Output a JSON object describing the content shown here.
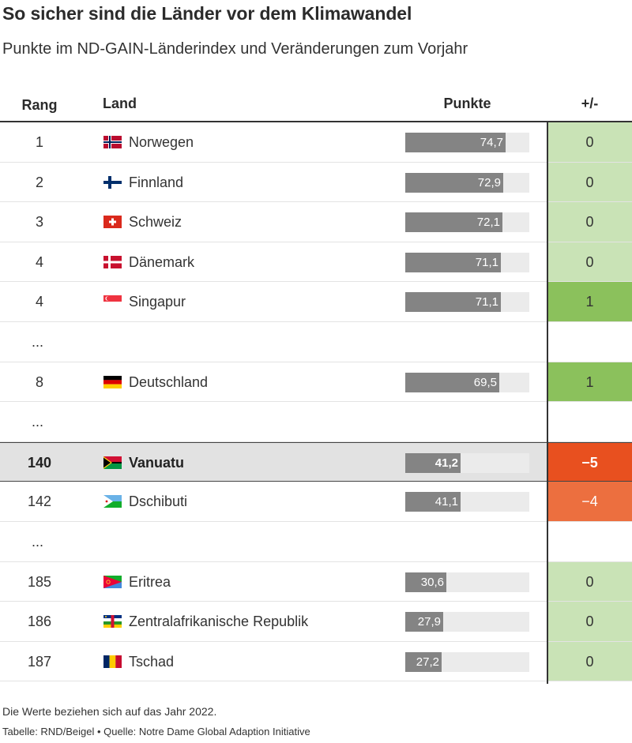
{
  "header": {
    "title": "So sicher sind die Länder vor dem Klimawandel",
    "subtitle": "Punkte im ND-GAIN-Länderindex und Veränderungen zum Vorjahr"
  },
  "columns": {
    "rank": "Rang",
    "country": "Land",
    "points": "Punkte",
    "change": "+/-"
  },
  "colors": {
    "bar": "#848484",
    "track": "#ebebeb",
    "change_zero": "#c9e3b6",
    "change_up": "#8bc15c",
    "change_down_strong": "#e8501f",
    "change_down": "#ec6f3f"
  },
  "chart_data": {
    "type": "table",
    "title": "So sicher sind die Länder vor dem Klimawandel",
    "subtitle": "Punkte im ND-GAIN-Länderindex und Veränderungen zum Vorjahr",
    "bar_scale_max": 92,
    "rows": [
      {
        "kind": "data",
        "rank": "1",
        "country": "Norwegen",
        "flag": "norway-flag-icon",
        "points": 74.7,
        "points_label": "74,7",
        "change": "0",
        "change_value": 0
      },
      {
        "kind": "data",
        "rank": "2",
        "country": "Finnland",
        "flag": "finland-flag-icon",
        "points": 72.9,
        "points_label": "72,9",
        "change": "0",
        "change_value": 0
      },
      {
        "kind": "data",
        "rank": "3",
        "country": "Schweiz",
        "flag": "switzerland-flag-icon",
        "points": 72.1,
        "points_label": "72,1",
        "change": "0",
        "change_value": 0
      },
      {
        "kind": "data",
        "rank": "4",
        "country": "Dänemark",
        "flag": "denmark-flag-icon",
        "points": 71.1,
        "points_label": "71,1",
        "change": "0",
        "change_value": 0
      },
      {
        "kind": "data",
        "rank": "4",
        "country": "Singapur",
        "flag": "singapore-flag-icon",
        "points": 71.1,
        "points_label": "71,1",
        "change": "1",
        "change_value": 1
      },
      {
        "kind": "gap",
        "text": "..."
      },
      {
        "kind": "data",
        "rank": "8",
        "country": "Deutschland",
        "flag": "germany-flag-icon",
        "points": 69.5,
        "points_label": "69,5",
        "change": "1",
        "change_value": 1
      },
      {
        "kind": "gap",
        "text": "..."
      },
      {
        "kind": "data",
        "rank": "140",
        "country": "Vanuatu",
        "flag": "vanuatu-flag-icon",
        "points": 41.2,
        "points_label": "41,2",
        "change": "−5",
        "change_value": -5,
        "highlight": true
      },
      {
        "kind": "data",
        "rank": "142",
        "country": "Dschibuti",
        "flag": "djibouti-flag-icon",
        "points": 41.1,
        "points_label": "41,1",
        "change": "−4",
        "change_value": -4
      },
      {
        "kind": "gap",
        "text": "..."
      },
      {
        "kind": "data",
        "rank": "185",
        "country": "Eritrea",
        "flag": "eritrea-flag-icon",
        "points": 30.6,
        "points_label": "30,6",
        "change": "0",
        "change_value": 0
      },
      {
        "kind": "data",
        "rank": "186",
        "country": "Zentralafrikanische Republik",
        "flag": "central-african-republic-flag-icon",
        "points": 27.9,
        "points_label": "27,9",
        "change": "0",
        "change_value": 0
      },
      {
        "kind": "data",
        "rank": "187",
        "country": "Tschad",
        "flag": "chad-flag-icon",
        "points": 27.2,
        "points_label": "27,2",
        "change": "0",
        "change_value": 0
      }
    ]
  },
  "footer": {
    "note": "Die Werte beziehen sich auf das Jahr 2022.",
    "source": "Tabelle: RND/Beigel • Quelle: Notre Dame Global Adaption Initiative"
  }
}
